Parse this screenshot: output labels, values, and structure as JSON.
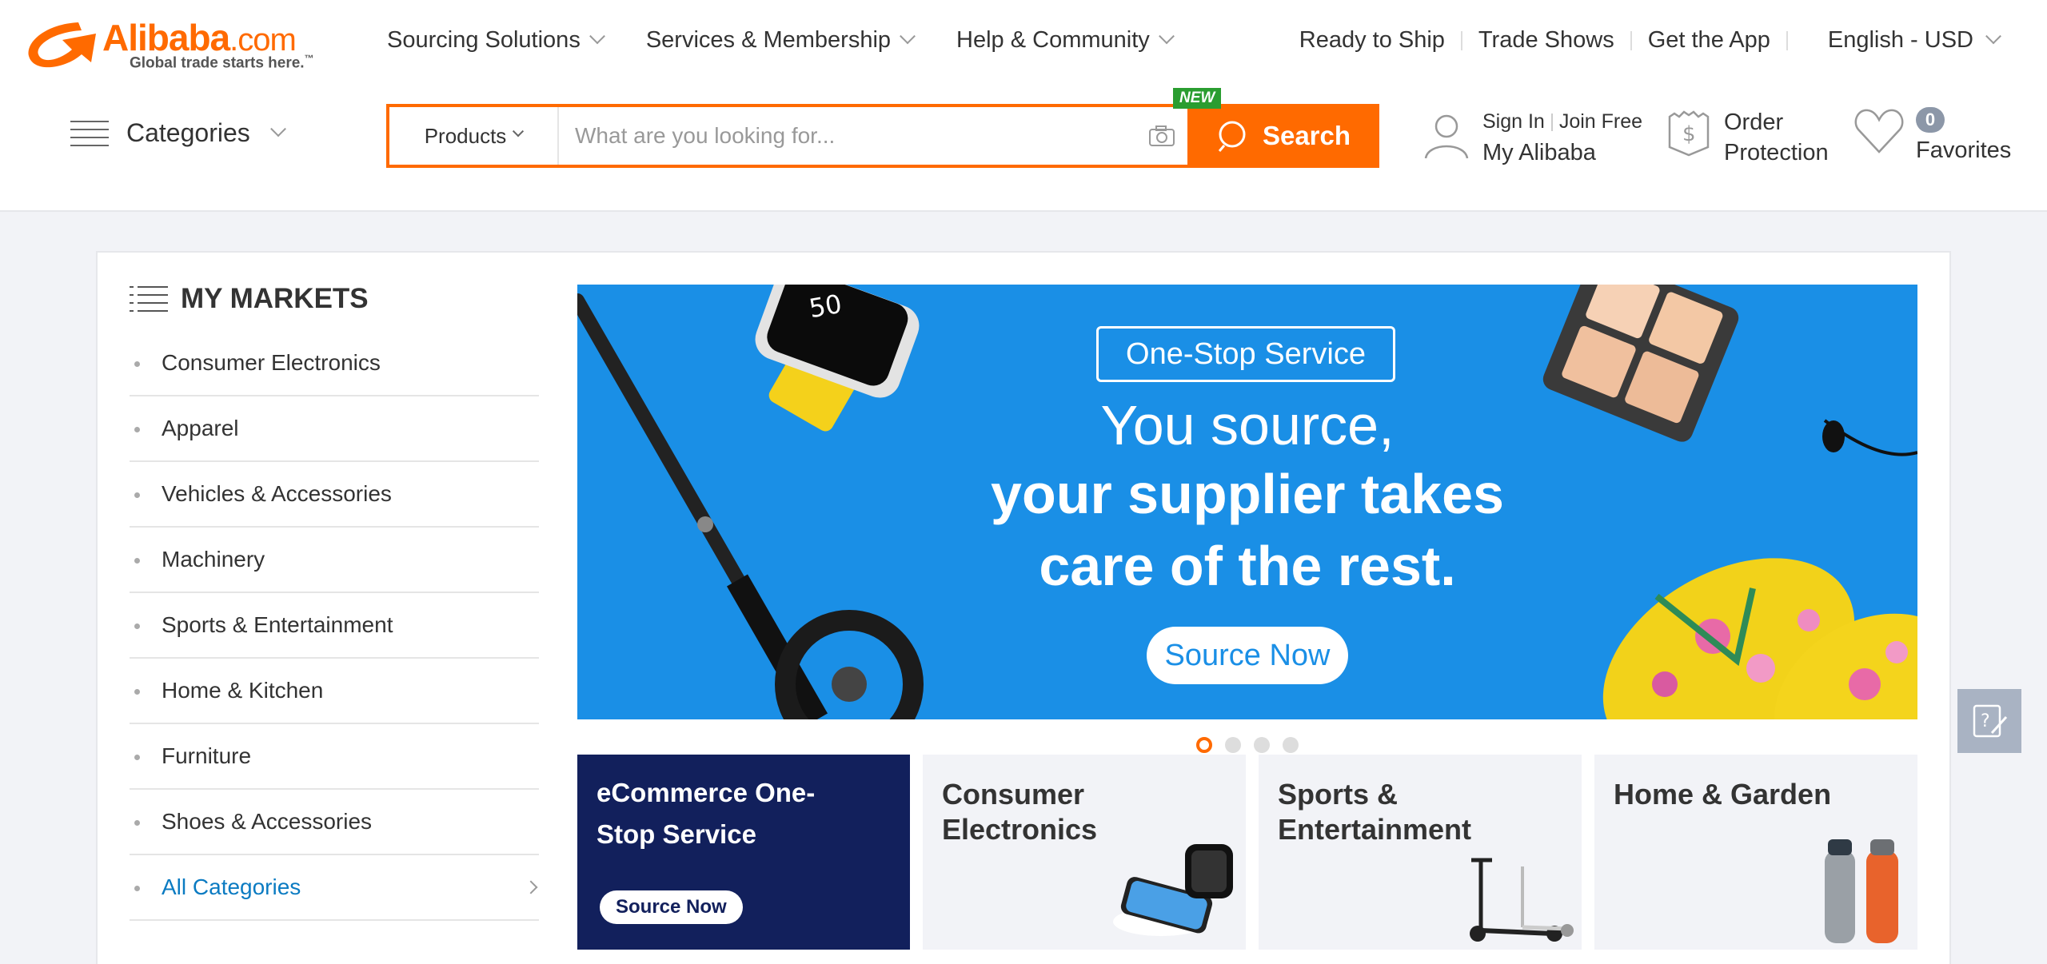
{
  "logo": {
    "brand": "Alibaba",
    "suffix": ".com",
    "tagline": "Global trade starts here.",
    "tm": "™"
  },
  "topnav": [
    {
      "label": "Sourcing Solutions"
    },
    {
      "label": "Services & Membership"
    },
    {
      "label": "Help & Community"
    }
  ],
  "toplinks": {
    "ready_to_ship": "Ready to Ship",
    "trade_shows": "Trade Shows",
    "get_app": "Get the App",
    "language": "English - USD"
  },
  "categories_label": "Categories",
  "search": {
    "type": "Products",
    "placeholder": "What are you looking for...",
    "button": "Search",
    "badge": "NEW"
  },
  "account": {
    "sign_in": "Sign In",
    "join": "Join Free",
    "my": "My Alibaba"
  },
  "order_protection": {
    "line1": "Order",
    "line2": "Protection"
  },
  "favorites": {
    "count": "0",
    "label": "Favorites"
  },
  "markets": {
    "heading": "MY MARKETS",
    "items": [
      "Consumer Electronics",
      "Apparel",
      "Vehicles & Accessories",
      "Machinery",
      "Sports & Entertainment",
      "Home & Kitchen",
      "Furniture",
      "Shoes & Accessories"
    ],
    "all": "All Categories"
  },
  "banner": {
    "tag": "One-Stop Service",
    "line1": "You source,",
    "line2": "your supplier takes",
    "line3": "care of the rest.",
    "cta": "Source Now",
    "watch_text": "50",
    "slides": 4,
    "active_slide": 1
  },
  "tiles": {
    "ecom": {
      "title": "eCommerce One-Stop Service",
      "button": "Source Now"
    },
    "electronics": {
      "title": "Consumer Electronics"
    },
    "sports": {
      "title": "Sports & Entertainment"
    },
    "home": {
      "title": "Home  &  Garden"
    }
  },
  "colors": {
    "brand_orange": "#ff6a00",
    "banner_blue": "#1a8fe6",
    "tile_navy": "#12205c",
    "link_blue": "#0b7bc2"
  }
}
